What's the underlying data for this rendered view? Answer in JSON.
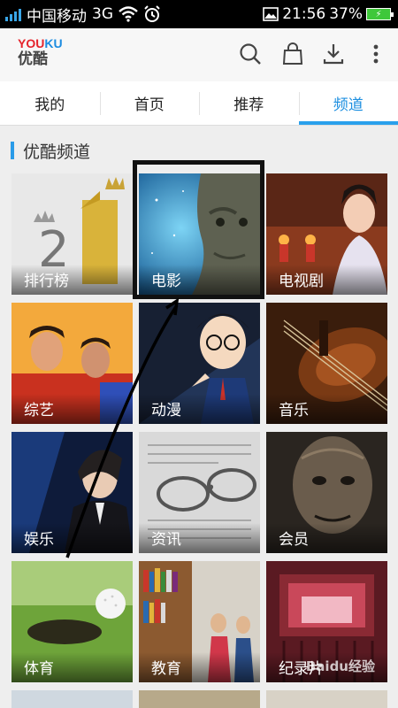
{
  "status_bar": {
    "carrier": "中国移动",
    "network": "3G",
    "time": "21:56",
    "battery": "37%"
  },
  "header": {
    "logo_top_y": "YOU",
    "logo_top_k": "KU",
    "logo_bottom": "优酷",
    "icons": [
      "search-icon",
      "shopping-bag-icon",
      "download-icon",
      "more-vertical-icon"
    ]
  },
  "tabs": [
    {
      "label": "我的",
      "active": false
    },
    {
      "label": "首页",
      "active": false
    },
    {
      "label": "推荐",
      "active": false
    },
    {
      "label": "频道",
      "active": true
    }
  ],
  "section": {
    "title": "优酷频道"
  },
  "channels": [
    {
      "label": "排行榜"
    },
    {
      "label": "电影"
    },
    {
      "label": "电视剧"
    },
    {
      "label": "综艺"
    },
    {
      "label": "动漫"
    },
    {
      "label": "音乐"
    },
    {
      "label": "娱乐"
    },
    {
      "label": "资讯"
    },
    {
      "label": "会员"
    },
    {
      "label": "体育"
    },
    {
      "label": "教育"
    },
    {
      "label": "纪录片"
    }
  ],
  "watermark": "Baidu经验",
  "colors": {
    "accent": "#1d8fe0",
    "logo_red": "#e5242c",
    "logo_blue": "#1c8ce0",
    "battery": "#3ec83a"
  }
}
